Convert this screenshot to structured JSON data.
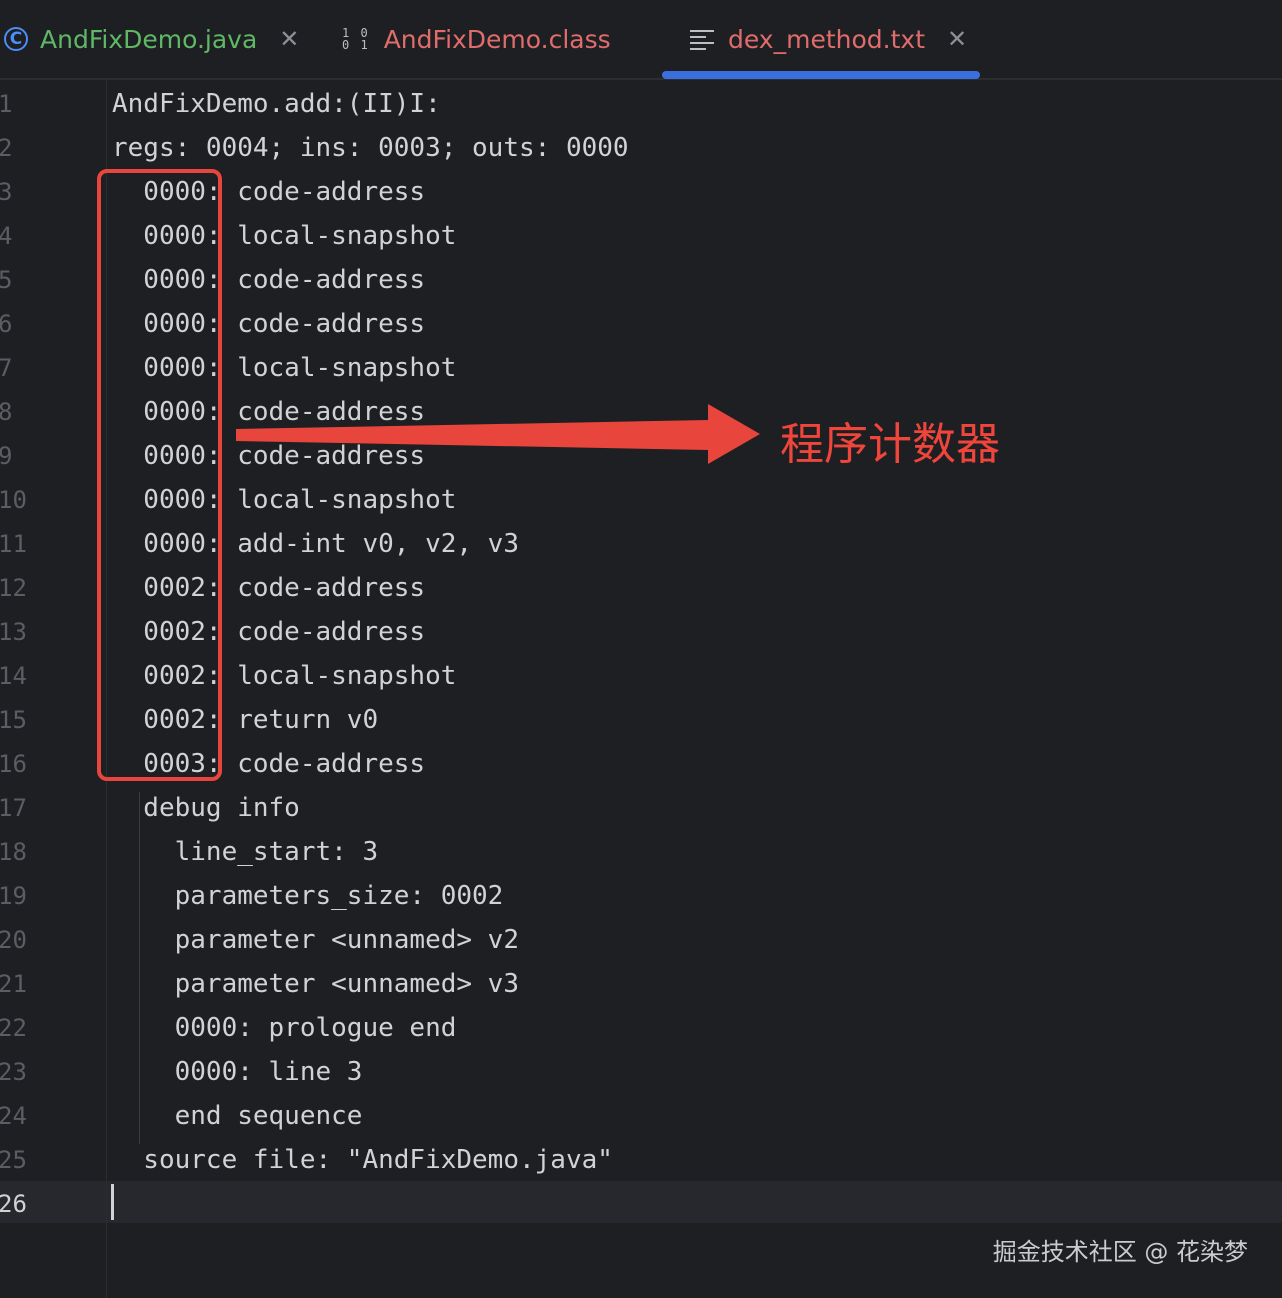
{
  "tabs": [
    {
      "label": "AndFixDemo.java",
      "icon": "java-class-icon",
      "closable": true
    },
    {
      "label": "AndFixDemo.class",
      "icon": "binary-class-icon",
      "icon_text": "10\n01",
      "closable": false
    },
    {
      "label": "dex_method.txt",
      "icon": "text-file-icon",
      "closable": true,
      "active": true
    }
  ],
  "editor": {
    "line_numbers": [
      "1",
      "2",
      "3",
      "4",
      "5",
      "6",
      "7",
      "8",
      "9",
      "10",
      "11",
      "12",
      "13",
      "14",
      "15",
      "16",
      "17",
      "18",
      "19",
      "20",
      "21",
      "22",
      "23",
      "24",
      "25",
      "26"
    ],
    "lines": [
      "AndFixDemo.add:(II)I:",
      "regs: 0004; ins: 0003; outs: 0000",
      "  0000: code-address",
      "  0000: local-snapshot",
      "  0000: code-address",
      "  0000: code-address",
      "  0000: local-snapshot",
      "  0000: code-address",
      "  0000: code-address",
      "  0000: local-snapshot",
      "  0000: add-int v0, v2, v3",
      "  0002: code-address",
      "  0002: code-address",
      "  0002: local-snapshot",
      "  0002: return v0",
      "  0003: code-address",
      "  debug info",
      "    line_start: 3",
      "    parameters_size: 0002",
      "    parameter <unnamed> v2",
      "    parameter <unnamed> v3",
      "    0000: prologue end",
      "    0000: line 3",
      "    end sequence",
      "  source file: \"AndFixDemo.java\"",
      ""
    ]
  },
  "annotation": {
    "label": "程序计数器",
    "color": "#e8453c"
  },
  "watermark": "掘金技术社区 @ 花染梦",
  "colors": {
    "background": "#1e1f22",
    "java_tab": "#5fb865",
    "modified_tab": "#e06c6c",
    "active_underline": "#3b6fe0"
  }
}
